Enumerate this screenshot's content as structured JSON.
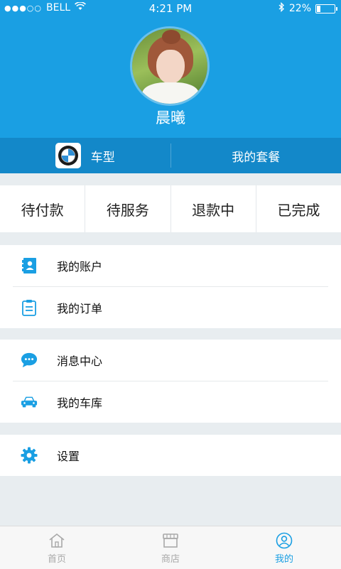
{
  "status_bar": {
    "carrier": "BELL",
    "time": "4:21 PM",
    "battery": "22%",
    "battery_level": 0.22
  },
  "profile": {
    "username": "晨曦"
  },
  "header_tabs": {
    "car_label": "车型",
    "package_label": "我的套餐"
  },
  "orders": [
    {
      "label": "待付款"
    },
    {
      "label": "待服务"
    },
    {
      "label": "退款中"
    },
    {
      "label": "已完成"
    }
  ],
  "menu": {
    "account": {
      "label": "我的账户",
      "icon": "account-icon"
    },
    "orders": {
      "label": "我的订单",
      "icon": "clipboard-icon"
    },
    "messages": {
      "label": "消息中心",
      "icon": "chat-bubble-icon"
    },
    "garage": {
      "label": "我的车库",
      "icon": "car-icon"
    },
    "settings": {
      "label": "设置",
      "icon": "gear-icon"
    }
  },
  "tabbar": {
    "home": "首页",
    "shop": "商店",
    "mine": "我的"
  },
  "colors": {
    "primary": "#1a9fe3",
    "tab_strip": "#1388c9",
    "background": "#e8edf0",
    "inactive_tab": "#a9a9a9"
  }
}
